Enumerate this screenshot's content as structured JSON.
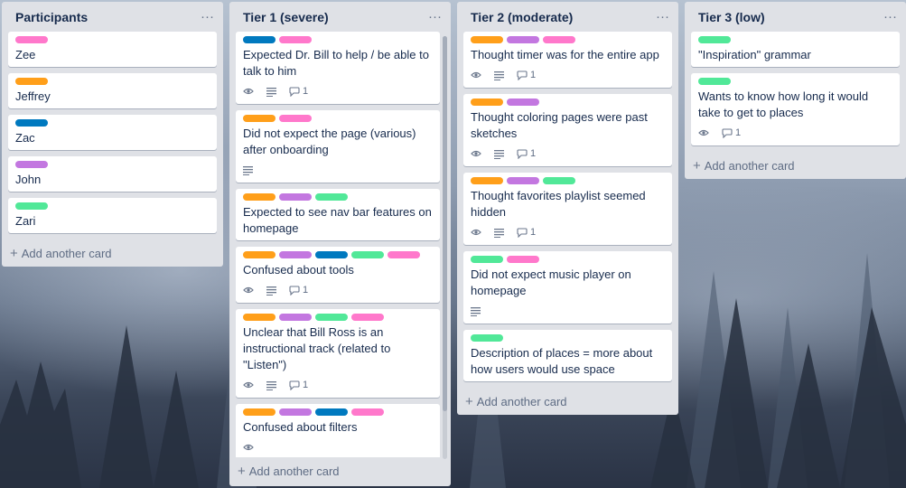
{
  "colors": {
    "pink": "#ff78cb",
    "orange": "#ff9f1a",
    "blue": "#0079bf",
    "purple": "#c377e0",
    "green": "#51e898"
  },
  "lists": [
    {
      "title": "Participants",
      "add_label": "Add another card",
      "cards": [
        {
          "labels": [
            "pink"
          ],
          "text": "Zee"
        },
        {
          "labels": [
            "orange"
          ],
          "text": "Jeffrey"
        },
        {
          "labels": [
            "blue"
          ],
          "text": "Zac"
        },
        {
          "labels": [
            "purple"
          ],
          "text": "John"
        },
        {
          "labels": [
            "green"
          ],
          "text": "Zari"
        }
      ]
    },
    {
      "title": "Tier 1 (severe)",
      "add_label": "Add another card",
      "cards": [
        {
          "labels": [
            "blue",
            "pink"
          ],
          "text": "Expected Dr. Bill to help / be able to talk to him",
          "badges": {
            "watch": true,
            "desc": true,
            "comments": "1"
          }
        },
        {
          "labels": [
            "orange",
            "pink"
          ],
          "text": "Did not expect the page (various) after onboarding",
          "badges": {
            "desc": true
          }
        },
        {
          "labels": [
            "orange",
            "purple",
            "green"
          ],
          "text": "Expected to see nav bar features on homepage"
        },
        {
          "labels": [
            "orange",
            "purple",
            "blue",
            "green",
            "pink"
          ],
          "text": "Confused about tools",
          "badges": {
            "watch": true,
            "desc": true,
            "comments": "1"
          }
        },
        {
          "labels": [
            "orange",
            "purple",
            "green",
            "pink"
          ],
          "text": "Unclear that Bill Ross is an instructional track (related to \"Listen\")",
          "badges": {
            "watch": true,
            "desc": true,
            "comments": "1"
          }
        },
        {
          "labels": [
            "orange",
            "purple",
            "blue",
            "pink"
          ],
          "text": "Confused about filters"
        }
      ]
    },
    {
      "title": "Tier 2 (moderate)",
      "add_label": "Add another card",
      "cards": [
        {
          "labels": [
            "orange",
            "purple",
            "pink"
          ],
          "text": "Thought timer was for the entire app",
          "badges": {
            "watch": true,
            "desc": true,
            "comments": "1"
          }
        },
        {
          "labels": [
            "orange",
            "purple"
          ],
          "text": "Thought coloring pages were past sketches",
          "badges": {
            "watch": true,
            "desc": true,
            "comments": "1"
          }
        },
        {
          "labels": [
            "orange",
            "purple",
            "green"
          ],
          "text": "Thought favorites playlist seemed hidden",
          "badges": {
            "watch": true,
            "desc": true,
            "comments": "1"
          }
        },
        {
          "labels": [
            "green",
            "pink"
          ],
          "text": "Did not expect music player on homepage",
          "badges": {
            "desc": true
          }
        },
        {
          "labels": [
            "green"
          ],
          "text": "Description of places = more about how users would use space"
        }
      ]
    },
    {
      "title": "Tier 3 (low)",
      "add_label": "Add another card",
      "cards": [
        {
          "labels": [
            "green"
          ],
          "text": "\"Inspiration\" grammar"
        },
        {
          "labels": [
            "green"
          ],
          "text": "Wants to know how long it would take to get to places",
          "badges": {
            "watch": true,
            "comments": "1"
          }
        }
      ]
    }
  ],
  "icons": {
    "menu": "ellipsis-icon",
    "watch": "eye-icon",
    "description": "description-icon",
    "comments": "comment-icon",
    "add": "plus-icon"
  }
}
